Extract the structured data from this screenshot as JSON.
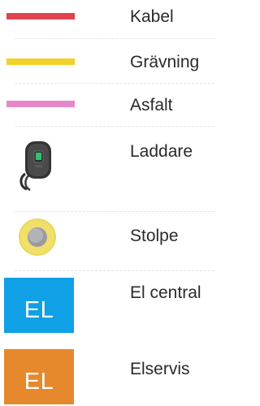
{
  "legend": {
    "items": [
      {
        "label": "Kabel",
        "symbol": "line",
        "color": "#e0444f"
      },
      {
        "label": "Grävning",
        "symbol": "line",
        "color": "#f2d22a"
      },
      {
        "label": "Asfalt",
        "symbol": "line",
        "color": "#e887c8"
      },
      {
        "label": "Laddare",
        "symbol": "charger-icon"
      },
      {
        "label": "Stolpe",
        "symbol": "pole-icon",
        "color": "#f0df6a"
      },
      {
        "label": "El central",
        "symbol": "box",
        "text": "EL",
        "color": "#10a0e6"
      },
      {
        "label": "Elservis",
        "symbol": "box",
        "text": "EL",
        "color": "#e6892c"
      }
    ]
  }
}
